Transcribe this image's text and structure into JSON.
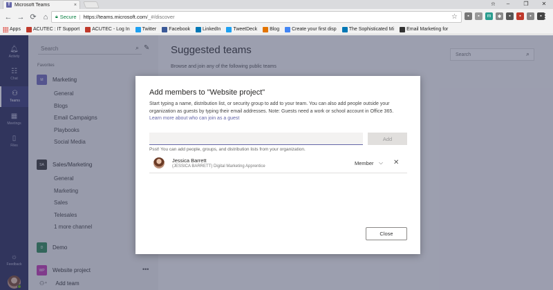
{
  "browser": {
    "tab_title": "Microsoft Teams",
    "tab_close": "×",
    "profile_icon": "⍾",
    "window_controls": [
      "–",
      "❐",
      "✕"
    ],
    "nav": {
      "back": "←",
      "forward": "→",
      "reload": "⟳",
      "home": "⌂"
    },
    "url": {
      "secure_label": "Secure",
      "scheme_host": "https://teams.microsoft.com",
      "path": "/_#/discover"
    },
    "star": "☆",
    "menu": "⋮",
    "bookmarks": [
      {
        "label": "Apps",
        "icon": "apps-grid-icon",
        "color": "#d93025"
      },
      {
        "label": "ACUTEC : IT Support",
        "icon": "acutec-icon",
        "color": "#c0392b"
      },
      {
        "label": "ACUTEC - Log In",
        "icon": "acutec-icon",
        "color": "#c0392b"
      },
      {
        "label": "Twitter",
        "icon": "twitter-icon",
        "color": "#1da1f2"
      },
      {
        "label": "Facebook",
        "icon": "facebook-icon",
        "color": "#3b5998"
      },
      {
        "label": "LinkedIn",
        "icon": "linkedin-icon",
        "color": "#0077b5"
      },
      {
        "label": "TweetDeck",
        "icon": "tweetdeck-icon",
        "color": "#1da1f2"
      },
      {
        "label": "Blog",
        "icon": "blog-icon",
        "color": "#e37400"
      },
      {
        "label": "Create your first disp",
        "icon": "google-icon",
        "color": "#4285f4"
      },
      {
        "label": "The Sophisticated Mi",
        "icon": "linkedin-icon",
        "color": "#0077b5"
      },
      {
        "label": "Email Marketing for",
        "icon": "email-marketing-icon",
        "color": "#333333"
      }
    ]
  },
  "rail": {
    "items": [
      {
        "label": "Activity",
        "icon": "bell-icon",
        "glyph": "🔔︎"
      },
      {
        "label": "Chat",
        "icon": "chat-icon",
        "glyph": "☷"
      },
      {
        "label": "Teams",
        "icon": "teams-icon",
        "glyph": "⚇"
      },
      {
        "label": "Meetings",
        "icon": "calendar-icon",
        "glyph": "▦"
      },
      {
        "label": "Files",
        "icon": "file-icon",
        "glyph": "▯"
      }
    ],
    "feedback": {
      "label": "Feedback",
      "icon": "lightbulb-icon",
      "glyph": "☼"
    }
  },
  "sidebar": {
    "search_placeholder": "Search",
    "search_glyph": "⌕",
    "compose_glyph": "✎",
    "favorites_label": "Favorites",
    "teams": [
      {
        "badge": "M",
        "name": "Marketing",
        "color": "#6f6ab8",
        "channels": [
          "General",
          "Blogs",
          "Email Campaigns",
          "Playbooks",
          "Social Media"
        ]
      },
      {
        "badge": "SA",
        "name": "Sales/Marketing",
        "color": "#3b3a39",
        "channels": [
          "General",
          "Marketing",
          "Sales",
          "Telesales",
          "1 more channel"
        ]
      },
      {
        "badge": "D",
        "name": "Demo",
        "color": "#2e8b57",
        "channels": []
      },
      {
        "badge": "WP",
        "name": "Website project",
        "color": "#c239b3",
        "channels": []
      }
    ],
    "more_glyph": "•••",
    "add_team": {
      "label": "Add team",
      "glyph": "⚇⁺"
    }
  },
  "main": {
    "title": "Suggested teams",
    "subtitle": "Browse and join any of the following public teams",
    "search_placeholder": "Search",
    "search_glyph": "⌕"
  },
  "dialog": {
    "title": "Add members to \"Website project\"",
    "description": "Start typing a name, distribution list, or security group to add to your team. You can also add people outside your organization as guests by typing their email addresses. Note: Guests need a work or school account in Office 365. ",
    "link_text": "Learn more about who can join as a guest",
    "input_value": "",
    "add_label": "Add",
    "hint": "Psst! You can add people, groups, and distribution lists from your organization.",
    "member": {
      "name": "Jessica Barrett",
      "title": "(JESSICA BARRETT) Digital Marketing Apprentice",
      "role": "Member",
      "chevron": "⌵",
      "remove": "✕"
    },
    "close_label": "Close"
  },
  "colors": {
    "teams_purple": "#6264a7",
    "rail_bg": "#2b2d5a",
    "overlay": "rgba(56,62,96,0.48)"
  }
}
